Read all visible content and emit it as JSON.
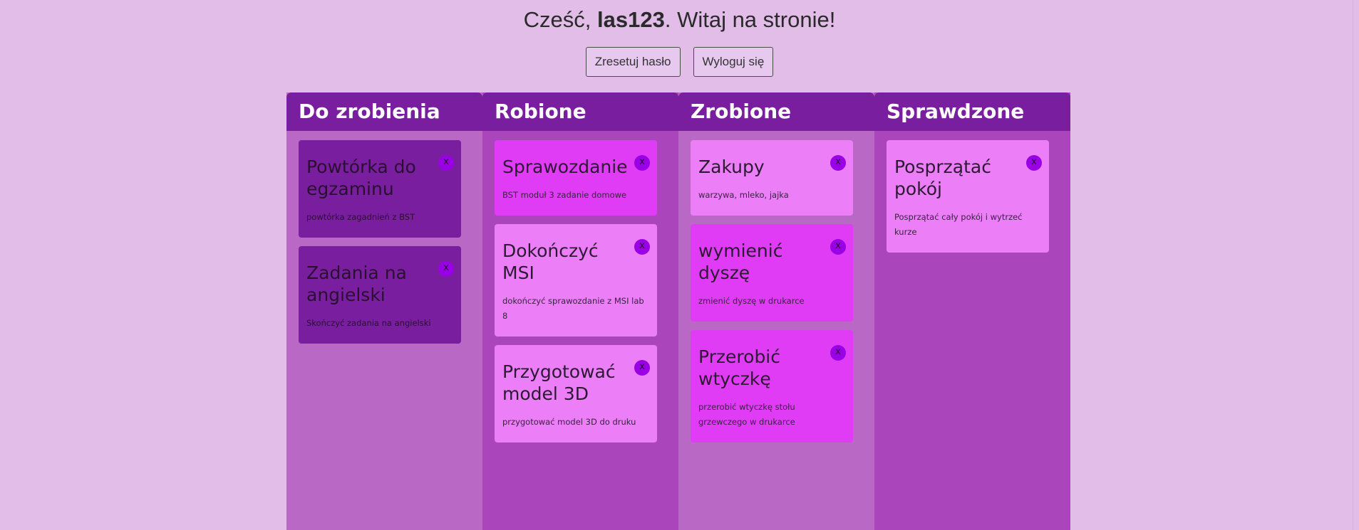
{
  "header": {
    "greeting_prefix": "Cześć, ",
    "username": "las123",
    "greeting_suffix": ". Witaj na stronie!",
    "reset_password_label": "Zresetuj hasło",
    "logout_label": "Wyloguj się"
  },
  "columns": [
    {
      "title": "Do zrobienia",
      "cards": [
        {
          "title": "Powtórka do egzaminu",
          "desc": "powtórka zagadnień z BST",
          "close": "x"
        },
        {
          "title": "Zadania na angielski",
          "desc": "Skończyć zadania na angielski",
          "close": "x"
        }
      ]
    },
    {
      "title": "Robione",
      "cards": [
        {
          "title": "Sprawozdanie",
          "desc": "BST moduł 3 zadanie domowe",
          "close": "x"
        },
        {
          "title": "Dokończyć MSI",
          "desc": "dokończyć sprawozdanie z MSI lab 8",
          "close": "x"
        },
        {
          "title": "Przygotować model 3D",
          "desc": "przygotować model 3D do druku",
          "close": "x"
        }
      ]
    },
    {
      "title": "Zrobione",
      "cards": [
        {
          "title": "Zakupy",
          "desc": "warzywa, mleko, jajka",
          "close": "x"
        },
        {
          "title": "wymienić dyszę",
          "desc": "zmienić dyszę w drukarce",
          "close": "x"
        },
        {
          "title": "Przerobić wtyczkę",
          "desc": "przerobić wtyczkę stołu grzewczego w drukarce",
          "close": "x"
        }
      ]
    },
    {
      "title": "Sprawdzone",
      "cards": [
        {
          "title": "Posprzątać pokój",
          "desc": "Posprzątać cały pokój i wytrzeć kurze",
          "close": "x"
        }
      ]
    }
  ],
  "colors": {
    "page_bg": "#e1bde8",
    "column_header": "#7a1ea0",
    "column_light": "#b968c6",
    "column_dark": "#ab45bb",
    "card_dark": "#7a1ea0",
    "card_hot": "#e03cf5",
    "card_soft": "#ec7ef8",
    "close_button": "#9a00e6"
  }
}
